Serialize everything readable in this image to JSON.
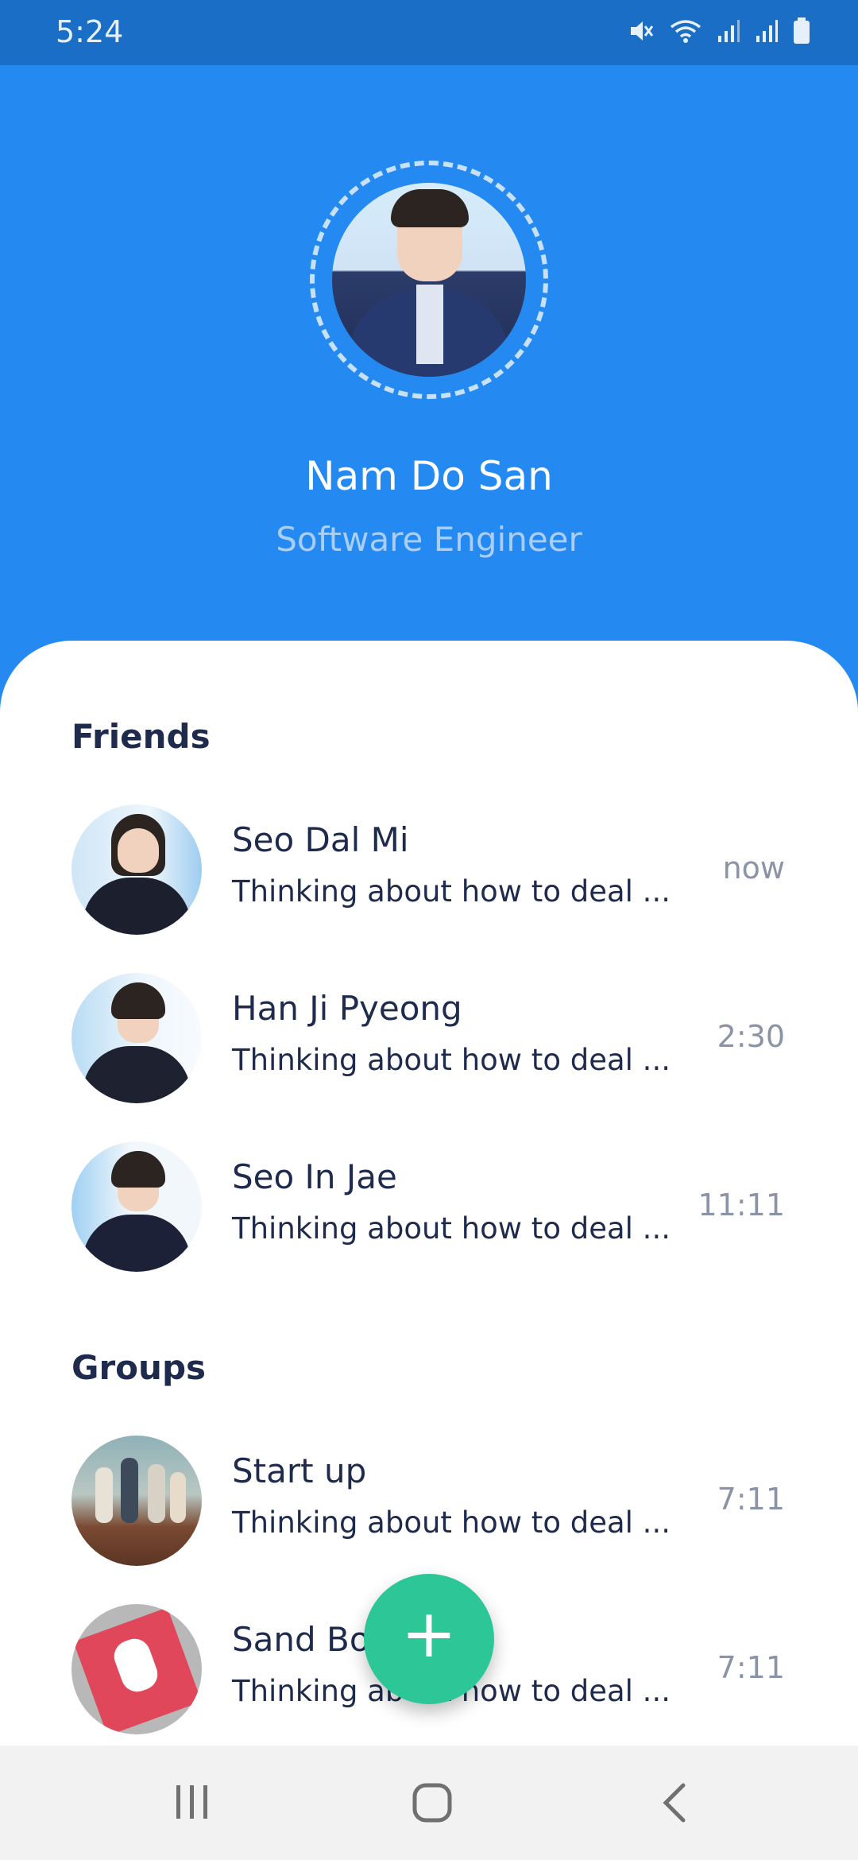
{
  "status_bar": {
    "time": "5:24",
    "icons": [
      "mute-icon",
      "wifi-icon",
      "signal-icon",
      "signal-icon",
      "battery-icon"
    ]
  },
  "profile": {
    "name": "Nam Do San",
    "role": "Software Engineer"
  },
  "friends": {
    "title": "Friends",
    "items": [
      {
        "name": "Seo Dal Mi",
        "message": "Thinking about how to deal ...",
        "time": "now"
      },
      {
        "name": "Han Ji Pyeong",
        "message": "Thinking about how to deal ...",
        "time": "2:30"
      },
      {
        "name": "Seo In Jae",
        "message": "Thinking about how to deal ...",
        "time": "11:11"
      }
    ]
  },
  "groups": {
    "title": "Groups",
    "items": [
      {
        "name": "Start up",
        "message": "Thinking about how to deal ...",
        "time": "7:11"
      },
      {
        "name": "Sand Box",
        "message": "Thinking about how to deal ...",
        "time": "7:11"
      }
    ]
  },
  "fab": {
    "symbol": "+",
    "icon": "plus-icon"
  },
  "colors": {
    "header_blue": "#2489F0",
    "status_blue": "#1A6EC5",
    "fab_green": "#2DC697",
    "text_dark": "#1F2B4D",
    "text_muted": "#8A94A6"
  },
  "nav_bar": {
    "buttons": [
      "recent-apps-icon",
      "home-icon",
      "back-icon"
    ]
  }
}
